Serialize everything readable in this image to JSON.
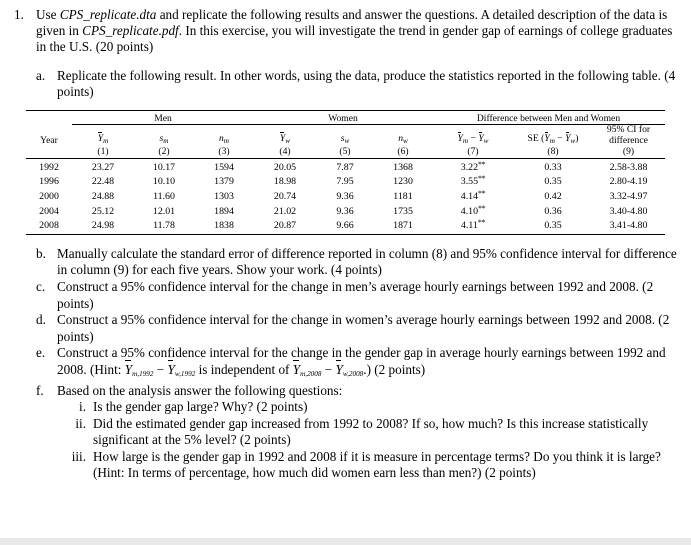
{
  "document": {
    "question_number": "1.",
    "intro": {
      "pre": "Use ",
      "file1": "CPS_replicate.dta",
      "mid": " and replicate the following results and answer the questions. A detailed description of the data is given in ",
      "file2": "CPS_replicate.pdf",
      "post": ". In this exercise, you will investigate the trend in gender gap of earnings of college graduates in the U.S. (20 points)"
    },
    "items": [
      {
        "marker": "a.",
        "text": "Replicate the following result. In other words, using the data, produce the statistics reported in the following table. (4 points)"
      },
      {
        "marker": "b.",
        "text": "Manually calculate the standard error of difference reported in column (8) and 95% confidence interval for difference in column (9) for each five years. Show your work. (4 points)"
      },
      {
        "marker": "c.",
        "text": "Construct a 95% confidence interval for the change in men’s average hourly earnings between 1992 and 2008. (2 points)"
      },
      {
        "marker": "d.",
        "text": "Construct a 95% confidence interval for the change in women’s average hourly earnings between 1992 and 2008. (2 points)"
      },
      {
        "marker": "e.",
        "hint_pre": "Construct a 95% confidence interval for the change in the gender gap in average hourly earnings between 1992 and 2008. (Hint: ",
        "hint_sym1": "Y",
        "hint_sub1": "m,1992",
        "hint_minus1": " − ",
        "hint_sym2": "Y",
        "hint_sub2": "w,1992",
        "hint_mid": " is independent of ",
        "hint_sym3": "Y",
        "hint_sub3": "m,2008",
        "hint_minus2": " − ",
        "hint_sym4": "Y",
        "hint_sub4": "w,2008",
        "hint_post": ".) (2 points)"
      },
      {
        "marker": "f.",
        "text": "Based on the analysis answer the following questions:"
      }
    ],
    "subitems": [
      {
        "marker": "i.",
        "text": "Is the gender gap large? Why? (2 points)"
      },
      {
        "marker": "ii.",
        "text": "Did the estimated gender gap increased from 1992 to 2008? If so, how much? Is this increase statistically significant at the 5% level? (2 points)"
      },
      {
        "marker": "iii.",
        "text": "How large is the gender gap in 1992 and 2008 if it is measure in percentage terms? Do you think it is large? (Hint: In terms of percentage, how much did women earn less than men?) (2 points)"
      }
    ]
  },
  "table": {
    "group_headers": {
      "year": "Year",
      "men": "Men",
      "women": "Women",
      "difference": "Difference between Men and Women"
    },
    "col_headers": {
      "ybar_m": {
        "sym": "Y",
        "sub": "m"
      },
      "s_m": {
        "sym": "s",
        "sub": "m"
      },
      "n_m": {
        "sym": "n",
        "sub": "m"
      },
      "ybar_w": {
        "sym": "Y",
        "sub": "w"
      },
      "s_w": {
        "sym": "s",
        "sub": "w"
      },
      "n_w": {
        "sym": "n",
        "sub": "w"
      },
      "diff": {
        "sym1": "Y",
        "sub1": "m",
        "minus": " − ",
        "sym2": "Y",
        "sub2": "w"
      },
      "se": {
        "prefix": "SE (",
        "sym1": "Y",
        "sub1": "m",
        "minus": " − ",
        "sym2": "Y",
        "sub2": "w",
        "suffix": ")"
      },
      "ci_line1": "95% CI for",
      "ci_line2": "difference"
    },
    "col_numbers": [
      "(1)",
      "(2)",
      "(3)",
      "(4)",
      "(5)",
      "(6)",
      "(7)",
      "(8)",
      "(9)"
    ],
    "rows": [
      {
        "year": "1992",
        "ybar_m": "23.27",
        "s_m": "10.17",
        "n_m": "1594",
        "ybar_w": "20.05",
        "s_w": "7.87",
        "n_w": "1368",
        "diff": "3.22",
        "diff_sig": "**",
        "se": "0.33",
        "ci": "2.58-3.88"
      },
      {
        "year": "1996",
        "ybar_m": "22.48",
        "s_m": "10.10",
        "n_m": "1379",
        "ybar_w": "18.98",
        "s_w": "7.95",
        "n_w": "1230",
        "diff": "3.55",
        "diff_sig": "**",
        "se": "0.35",
        "ci": "2.80-4.19"
      },
      {
        "year": "2000",
        "ybar_m": "24.88",
        "s_m": "11.60",
        "n_m": "1303",
        "ybar_w": "20.74",
        "s_w": "9.36",
        "n_w": "1181",
        "diff": "4.14",
        "diff_sig": "**",
        "se": "0.42",
        "ci": "3.32-4.97"
      },
      {
        "year": "2004",
        "ybar_m": "25.12",
        "s_m": "12.01",
        "n_m": "1894",
        "ybar_w": "21.02",
        "s_w": "9.36",
        "n_w": "1735",
        "diff": "4.10",
        "diff_sig": "**",
        "se": "0.36",
        "ci": "3.40-4.80"
      },
      {
        "year": "2008",
        "ybar_m": "24.98",
        "s_m": "11.78",
        "n_m": "1838",
        "ybar_w": "20.87",
        "s_w": "9.66",
        "n_w": "1871",
        "diff": "4.11",
        "diff_sig": "**",
        "se": "0.35",
        "ci": "3.41-4.80"
      }
    ]
  }
}
